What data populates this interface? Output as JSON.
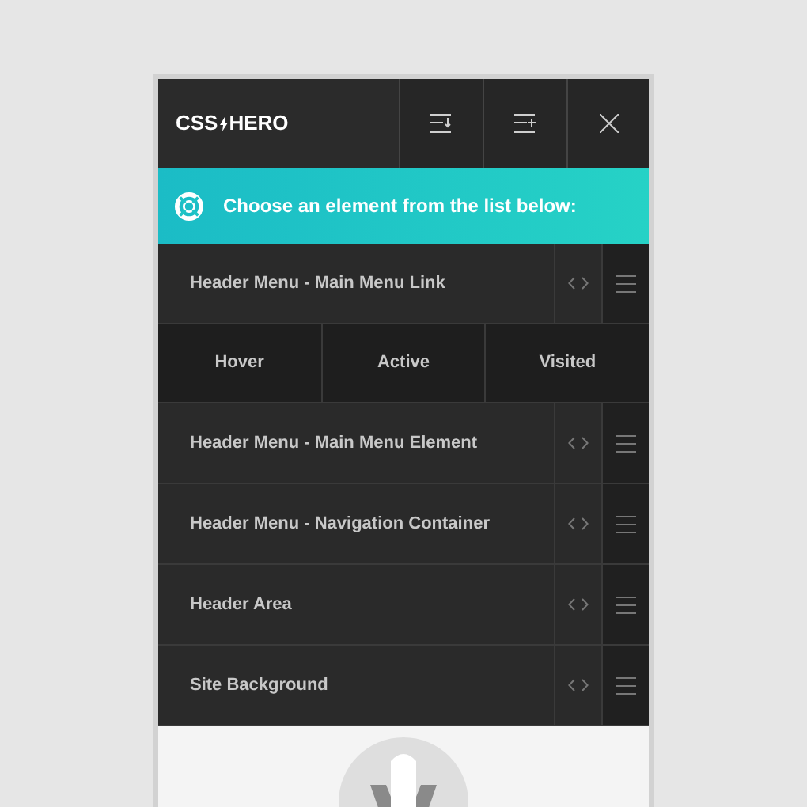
{
  "header": {
    "logo_left": "CSS",
    "logo_right": "HERO"
  },
  "banner": {
    "text": "Choose an element from the list below:"
  },
  "rows": [
    {
      "kind": "element",
      "label": "Header Menu - Main Menu Link"
    },
    {
      "kind": "states",
      "states": [
        "Hover",
        "Active",
        "Visited"
      ]
    },
    {
      "kind": "element",
      "label": "Header Menu - Main Menu Element"
    },
    {
      "kind": "element",
      "label": "Header Menu - Navigation Container"
    },
    {
      "kind": "element",
      "label": "Header Area"
    },
    {
      "kind": "element",
      "label": "Site Background"
    }
  ]
}
